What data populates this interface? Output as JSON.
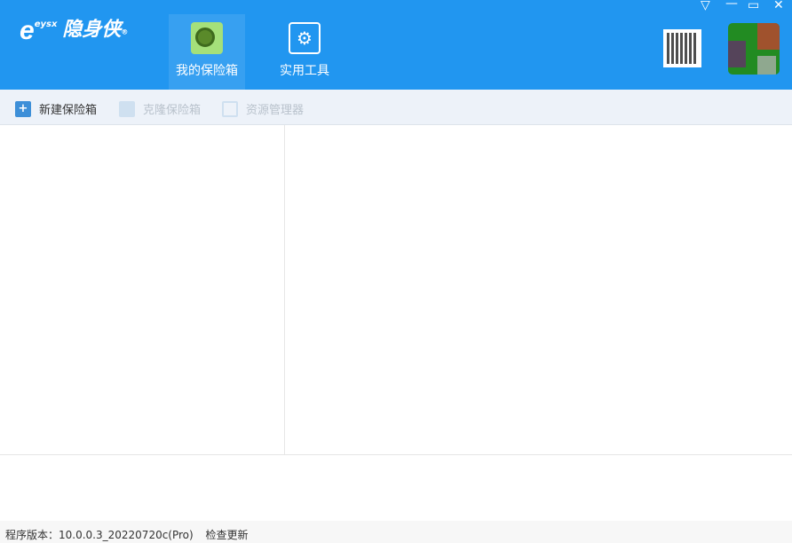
{
  "app": {
    "logo_mark": "eysx",
    "name": "隐身侠"
  },
  "nav": [
    {
      "label": "我的保险箱",
      "icon": "safe-icon",
      "active": true
    },
    {
      "label": "实用工具",
      "icon": "tools-icon",
      "active": false
    }
  ],
  "window_controls": [
    "menu",
    "minimize",
    "maximize",
    "close"
  ],
  "toolbar": {
    "new": "新建保险箱",
    "clone": "克隆保险箱",
    "explorer": "资源管理器"
  },
  "status": {
    "version_label": "程序版本：",
    "version": "10.0.0.3_20220720c(Pro)",
    "check_update": "检查更新"
  }
}
